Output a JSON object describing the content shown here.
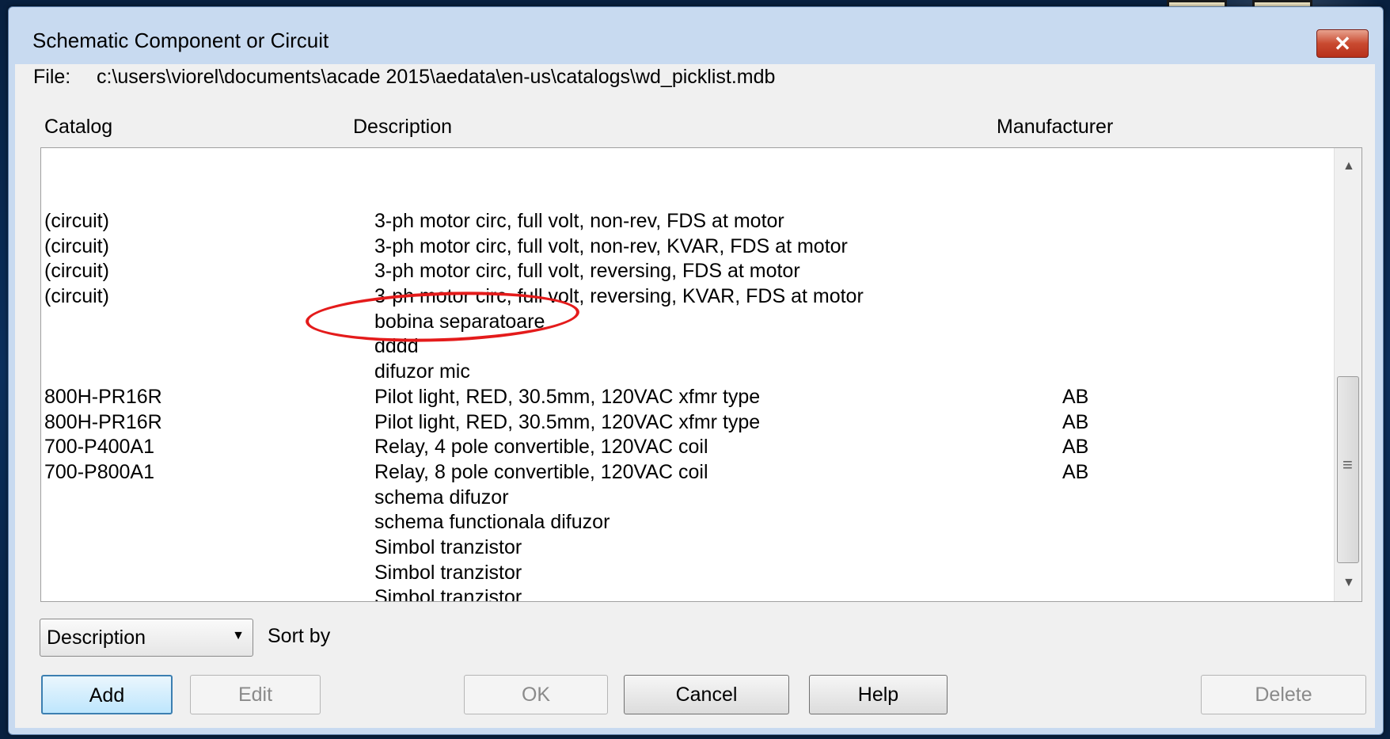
{
  "window": {
    "title": "Schematic Component or Circuit",
    "close_glyph": "✕"
  },
  "file": {
    "label": "File:",
    "path": "c:\\users\\viorel\\documents\\acade 2015\\aedata\\en-us\\catalogs\\wd_picklist.mdb"
  },
  "columns": {
    "catalog": "Catalog",
    "description": "Description",
    "manufacturer": "Manufacturer"
  },
  "rows": [
    {
      "catalog": "(circuit)",
      "description": "3-ph motor circ, full volt, non-rev, FDS at motor",
      "manufacturer": ""
    },
    {
      "catalog": "(circuit)",
      "description": "3-ph motor circ, full volt, non-rev, KVAR, FDS at motor",
      "manufacturer": ""
    },
    {
      "catalog": "(circuit)",
      "description": "3-ph motor circ, full volt, reversing, FDS at motor",
      "manufacturer": ""
    },
    {
      "catalog": "(circuit)",
      "description": "3-ph motor circ, full volt, reversing, KVAR, FDS at motor",
      "manufacturer": ""
    },
    {
      "catalog": "",
      "description": "bobina separatoare",
      "manufacturer": ""
    },
    {
      "catalog": "",
      "description": "dddd",
      "manufacturer": ""
    },
    {
      "catalog": "",
      "description": "difuzor mic",
      "manufacturer": ""
    },
    {
      "catalog": "800H-PR16R",
      "description": "Pilot light, RED, 30.5mm, 120VAC xfmr type",
      "manufacturer": "AB"
    },
    {
      "catalog": "800H-PR16R",
      "description": "Pilot light, RED, 30.5mm, 120VAC xfmr type",
      "manufacturer": "AB"
    },
    {
      "catalog": "700-P400A1",
      "description": "Relay, 4 pole convertible, 120VAC coil",
      "manufacturer": "AB"
    },
    {
      "catalog": "700-P800A1",
      "description": "Relay, 8 pole convertible, 120VAC coil",
      "manufacturer": "AB"
    },
    {
      "catalog": "",
      "description": "schema difuzor",
      "manufacturer": ""
    },
    {
      "catalog": "",
      "description": "schema functionala difuzor",
      "manufacturer": ""
    },
    {
      "catalog": "",
      "description": "Simbol tranzistor",
      "manufacturer": ""
    },
    {
      "catalog": "",
      "description": "Simbol tranzistor",
      "manufacturer": ""
    },
    {
      "catalog": "",
      "description": "Simbol tranzistor",
      "manufacturer": ""
    }
  ],
  "scrollbar": {
    "up_icon": "▲",
    "down_icon": "▼",
    "grip_icon": "≡"
  },
  "sort": {
    "selected": "Description",
    "arrow_icon": "▼",
    "label": "Sort by"
  },
  "buttons": {
    "add": "Add",
    "edit": "Edit",
    "ok": "OK",
    "cancel": "Cancel",
    "help": "Help",
    "delete": "Delete"
  },
  "colors": {
    "annotation": "#e41b1b",
    "default_button_border": "#3c7fb1",
    "close_button": "#c94a30"
  }
}
